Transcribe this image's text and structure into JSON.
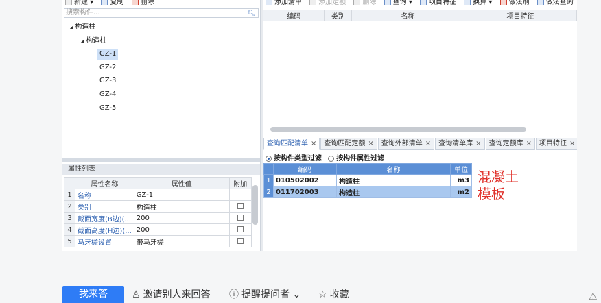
{
  "left_toolbar": {
    "items": [
      {
        "label": "新建",
        "icon": "new-icon"
      },
      {
        "label": "复制",
        "icon": "copy-icon"
      },
      {
        "label": "删除",
        "icon": "delete-icon"
      }
    ]
  },
  "right_toolbar": {
    "items": [
      {
        "label": "添加清单",
        "icon": "add-list-icon"
      },
      {
        "label": "添加定额",
        "icon": "add-quota-icon"
      },
      {
        "label": "删除",
        "icon": "delete-icon"
      },
      {
        "label": "查询",
        "icon": "query-icon"
      },
      {
        "label": "项目特征",
        "icon": "feature-icon"
      },
      {
        "label": "换算",
        "icon": "fx-icon"
      },
      {
        "label": "做法刷",
        "icon": "brush-icon"
      },
      {
        "label": "做法查询",
        "icon": "method-query-icon"
      }
    ]
  },
  "search": {
    "placeholder": "搜索构件..."
  },
  "tree": {
    "root": "构造柱",
    "child": "构造柱",
    "items": [
      "GZ-1",
      "GZ-2",
      "GZ-3",
      "GZ-4",
      "GZ-5"
    ],
    "selected": "GZ-1"
  },
  "properties": {
    "title": "属性列表",
    "headers": [
      "属性名称",
      "属性值",
      "附加"
    ],
    "rows": [
      {
        "num": "1",
        "name": "名称",
        "value": "GZ-1",
        "has_check": false
      },
      {
        "num": "2",
        "name": "类别",
        "value": "构造柱",
        "has_check": true
      },
      {
        "num": "3",
        "name": "截面宽度(B边)(...",
        "value": "200",
        "has_check": true
      },
      {
        "num": "4",
        "name": "截面高度(H边)(...",
        "value": "200",
        "has_check": true
      },
      {
        "num": "5",
        "name": "马牙槎设置",
        "value": "带马牙槎",
        "has_check": true
      }
    ]
  },
  "upper_grid": {
    "headers": [
      "编码",
      "类别",
      "名称",
      "项目特征"
    ]
  },
  "tabs": [
    {
      "label": "查询匹配清单",
      "active": true
    },
    {
      "label": "查询匹配定额",
      "active": false
    },
    {
      "label": "查询外部清单",
      "active": false
    },
    {
      "label": "查询清单库",
      "active": false
    },
    {
      "label": "查询定额库",
      "active": false
    },
    {
      "label": "项目特征",
      "active": false
    }
  ],
  "filters": {
    "by_type": "按构件类型过滤",
    "by_attr": "按构件属性过滤"
  },
  "match_grid": {
    "headers": [
      "编码",
      "名称",
      "单位"
    ],
    "rows": [
      {
        "num": "1",
        "code": "010502002",
        "name": "构造柱",
        "unit": "m3"
      },
      {
        "num": "2",
        "code": "011702003",
        "name": "构造柱",
        "unit": "m2"
      }
    ]
  },
  "annotation": {
    "line1": "混凝土",
    "line2": "模板"
  },
  "bottom_bar": {
    "answer_button": "我来答",
    "invite": "邀请别人来回答",
    "remind": "提醒提问者",
    "favorite": "收藏"
  },
  "colors": {
    "accent": "#2e7cf6",
    "grid_header": "#5b8fd6",
    "annotation": "#e0302a"
  }
}
